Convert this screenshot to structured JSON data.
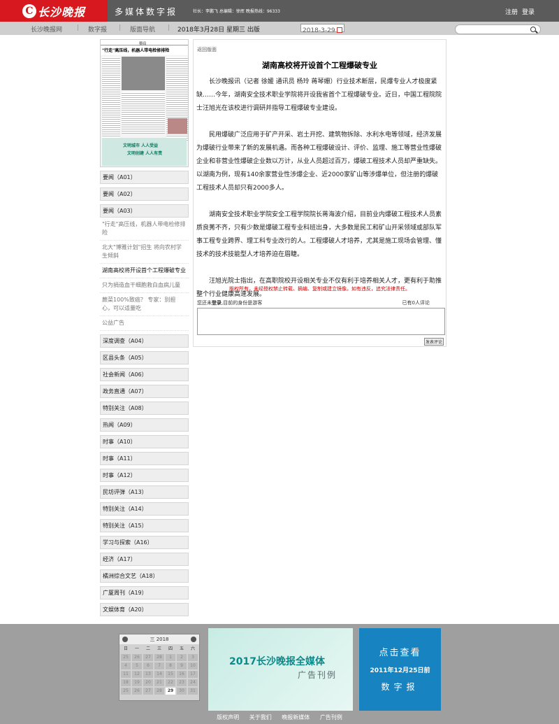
{
  "header": {
    "logo_mark": "C",
    "logo_text": "长沙晚报",
    "site_name": "多媒体数字报",
    "staff": "社长：李鹏飞 总编辑：徐挥 晚报热线：96333",
    "register": "注册",
    "login": "登录"
  },
  "nav": {
    "items": [
      "长沙晚报网",
      "数字报",
      "版面导航"
    ],
    "issue": "2018年3月28日 星期三 出版",
    "date_value": "2018-3-29",
    "search_placeholder": ""
  },
  "thumbnail": {
    "page_label": "要闻",
    "headline": "\"行走\"高压线，机器人带电检修排险",
    "ad_line1": "文明城市 人人受益",
    "ad_line2": "文明创建 人人有责"
  },
  "sections": [
    {
      "label": "要闻（A01）",
      "subs": []
    },
    {
      "label": "要闻（A02）",
      "subs": []
    },
    {
      "label": "要闻（A03）",
      "subs": [
        "\"行走\"高压线，机器人带电检修排险",
        "北大\"博雅计划\"招生 将向农村学生倾斜",
        "湖南高校将开设首个工程爆破专业",
        "只为捐造血干细胞救白血病儿童",
        "蕨菜100%致癌？ 专家：别担心，可以适量吃",
        "公益广告"
      ]
    },
    {
      "label": "深度调查（A04）",
      "subs": []
    },
    {
      "label": "区县头条（A05）",
      "subs": []
    },
    {
      "label": "社会新闻（A06）",
      "subs": []
    },
    {
      "label": "政务直通（A07）",
      "subs": []
    },
    {
      "label": "特别关注（A08）",
      "subs": []
    },
    {
      "label": "热闻（A09）",
      "subs": []
    },
    {
      "label": "时事（A10）",
      "subs": []
    },
    {
      "label": "时事（A11）",
      "subs": []
    },
    {
      "label": "时事（A12）",
      "subs": []
    },
    {
      "label": "民坊评弹（A13）",
      "subs": []
    },
    {
      "label": "特别关注（A14）",
      "subs": []
    },
    {
      "label": "特别关注（A15）",
      "subs": []
    },
    {
      "label": "学习与探索（A16）",
      "subs": []
    },
    {
      "label": "经济（A17）",
      "subs": []
    },
    {
      "label": "橘洲综合文艺（A18）",
      "subs": []
    },
    {
      "label": "广厦周刊（A19）",
      "subs": []
    },
    {
      "label": "文娱体育（A20）",
      "subs": []
    }
  ],
  "article": {
    "back": "返回版面",
    "title": "湖南高校将开设首个工程爆破专业",
    "paragraphs": [
      "长沙晚报讯（记者 徐媛 通讯员 杨玲 蒋琴姗）行业技术断层，民爆专业人才极度紧缺……今年，湖南安全技术职业学院将开设我省首个工程爆破专业。近日，中国工程院院士汪旭光在该校进行调研并指导工程爆破专业建设。",
      "民用爆破广泛应用于矿产开采、岩土开挖、建筑物拆除、水利水电等领域，经济发展为爆破行业带来了新的发展机遇。而各种工程爆破设计、评价、监理、施工等营业性爆破企业和非营业性爆破企业数以万计，从业人员超过百万，爆破工程技术人员却严重缺失。以湖南为例，现有140余家营业性涉爆企业、近2000家矿山等涉爆单位，但注册的爆破工程技术人员却只有2000多人。",
      "湖南安全技术职业学院安全工程学院院长蒋海波介绍，目前业内爆破工程技术人员素质良莠不齐，只有少数是爆破工程专业科班出身，大多数是民工和矿山开采领域或部队军事工程专业跨界、理工科专业改行的人。工程爆破人才培养，尤其是施工现场会管理、懂技术的技术技能型人才培养迫在眉睫。",
      "汪旭光院士指出，在高职院校开设相关专业不仅有利于培养相关人才，更有利于助推整个行业健康高速发展。"
    ],
    "rights": "版权所有，未经授权禁止转载、摘编、复制或建立镜像。如有违反，追究法律责任。",
    "comment_prefix": "您还未",
    "comment_login": "登录",
    "comment_suffix": ",目前的身份是游客",
    "comment_count": "已有0人评论",
    "submit": "发表评论"
  },
  "calendar": {
    "title": "三 2018",
    "weekdays": [
      "日",
      "一",
      "二",
      "三",
      "四",
      "五",
      "六"
    ],
    "rows": [
      [
        "25",
        "26",
        "27",
        "28",
        "1",
        "2",
        "3"
      ],
      [
        "4",
        "5",
        "6",
        "7",
        "8",
        "9",
        "10"
      ],
      [
        "11",
        "12",
        "13",
        "14",
        "15",
        "16",
        "17"
      ],
      [
        "18",
        "19",
        "20",
        "21",
        "22",
        "23",
        "24"
      ],
      [
        "25",
        "26",
        "27",
        "28",
        "29",
        "30",
        "31"
      ]
    ],
    "today": "29"
  },
  "ads": {
    "ad1_title": "2017长沙晚报全媒体",
    "ad1_sub": "广告刊例",
    "ad2_a": "点击查看",
    "ad2_b": "2011年12月25日前",
    "ad2_c": "数字报"
  },
  "footer": {
    "links": [
      "版权声明",
      "关于我们",
      "晚报新媒体",
      "广告刊例"
    ]
  }
}
